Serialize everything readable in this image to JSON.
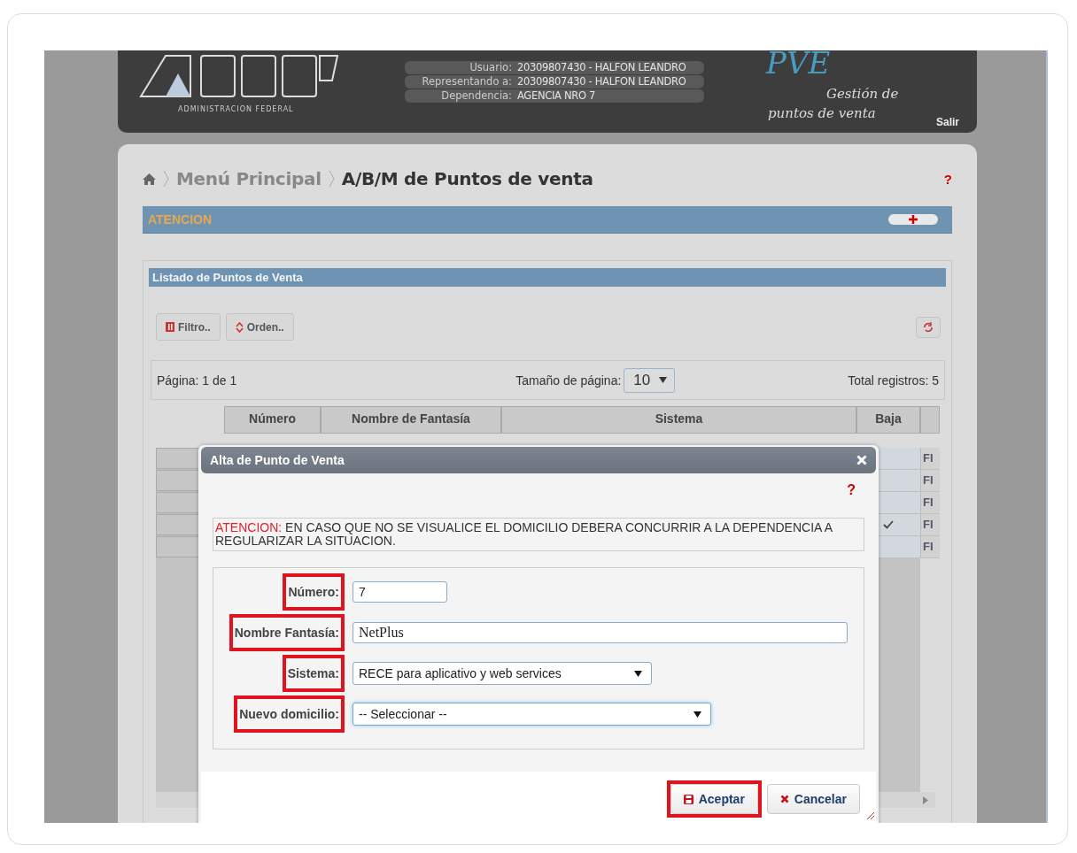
{
  "header": {
    "logo_text": "ADMINISTRACION FEDERAL",
    "user_info": [
      {
        "label": "Usuario:",
        "value": "20309807430 - HALFON LEANDRO"
      },
      {
        "label": "Representando a:",
        "value": "20309807430 - HALFON LEANDRO"
      },
      {
        "label": "Dependencia:",
        "value": "AGENCIA NRO 7"
      }
    ],
    "brand": "PVE",
    "brand_line_1": "Gestión de",
    "brand_line_2": "puntos de venta",
    "logout": "Salir"
  },
  "breadcrumb": {
    "items": [
      "Menú Principal",
      "A/B/M de Puntos de venta"
    ],
    "help": "?"
  },
  "notice_bar": {
    "title": "ATENCION",
    "expanded": false
  },
  "listing": {
    "title": "Listado de Puntos de Venta",
    "toolbar": [
      {
        "label": "Filtro..",
        "kind": "filter"
      },
      {
        "label": "Orden..",
        "kind": "sort"
      }
    ],
    "pager": {
      "page": "Página: 1 de 1",
      "page_size_label": "Tamaño de página:",
      "page_size": "10",
      "total": "Total registros: 5"
    },
    "columns": [
      "Número",
      "Nombre de Fantasía",
      "Sistema",
      "Baja"
    ],
    "rows": [
      {
        "baja": false,
        "column_5": "FI"
      },
      {
        "baja": false,
        "column_5": "FI"
      },
      {
        "baja": false,
        "column_5": "FI"
      },
      {
        "baja": true,
        "column_5": "FI"
      },
      {
        "baja": false,
        "column_5": "FI"
      }
    ]
  },
  "dialog": {
    "title": "Alta de Punto de Venta",
    "help": "?",
    "notice": {
      "label": "ATENCION:",
      "text": "EN CASO QUE NO SE VISUALICE EL DOMICILIO DEBERA CONCURRIR A LA DEPENDENCIA A REGULARIZAR LA SITUACION."
    },
    "fields": [
      {
        "label": "Número:",
        "kind": "text",
        "value": "7",
        "highlighted": true,
        "focused": false
      },
      {
        "label": "Nombre Fantasía:",
        "kind": "text",
        "value": "NetPlus",
        "highlighted": true,
        "focused": false
      },
      {
        "label": "Sistema:",
        "kind": "select",
        "value": "RECE para aplicativo y web services",
        "highlighted": true,
        "focused": false
      },
      {
        "label": "Nuevo domicilio:",
        "kind": "select",
        "value": "-- Seleccionar --",
        "highlighted": true,
        "focused": true
      }
    ],
    "buttons": [
      {
        "label": "Aceptar",
        "kind": "save",
        "highlighted": true
      },
      {
        "label": "Cancelar",
        "kind": "cancel",
        "highlighted": false
      }
    ]
  }
}
